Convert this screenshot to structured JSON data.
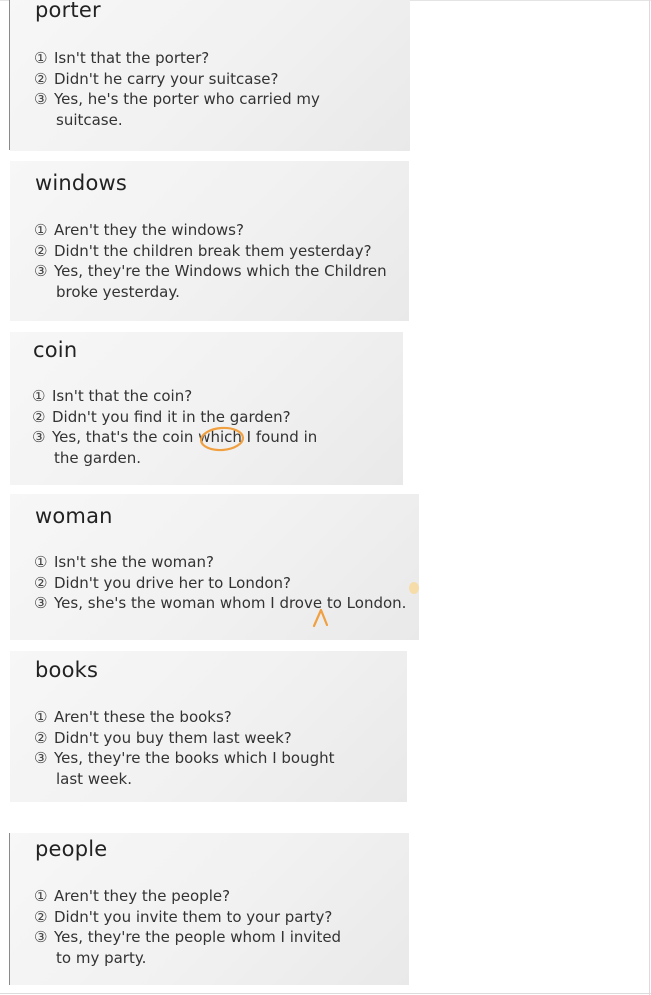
{
  "cards": [
    {
      "word": "porter",
      "lines": [
        {
          "num": "①",
          "text": "Isn't that the porter?"
        },
        {
          "num": "②",
          "text": "Didn't he carry your suitcase?"
        },
        {
          "num": "③",
          "text": "Yes, he's the porter who carried my"
        },
        {
          "num": "",
          "text": "suitcase."
        }
      ]
    },
    {
      "word": "windows",
      "lines": [
        {
          "num": "①",
          "text": "Aren't they the windows?"
        },
        {
          "num": "②",
          "text": "Didn't the children break them yesterday?"
        },
        {
          "num": "③",
          "text": "Yes, they're the Windows which the Children"
        },
        {
          "num": "",
          "text": "broke yesterday."
        }
      ]
    },
    {
      "word": "coin",
      "lines": [
        {
          "num": "①",
          "text": "Isn't that the coin?"
        },
        {
          "num": "②",
          "text": "Didn't you find it in the garden?"
        },
        {
          "num": "③",
          "text": "Yes, that's the coin which I found in"
        },
        {
          "num": "",
          "text": "the garden."
        }
      ]
    },
    {
      "word": "woman",
      "lines": [
        {
          "num": "①",
          "text": "Isn't she the woman?"
        },
        {
          "num": "②",
          "text": "Didn't you drive her to London?"
        },
        {
          "num": "③",
          "text": "Yes, she's the woman whom I drove to London."
        }
      ]
    },
    {
      "word": "books",
      "lines": [
        {
          "num": "①",
          "text": "Aren't these the books?"
        },
        {
          "num": "②",
          "text": "Didn't you buy them last week?"
        },
        {
          "num": "③",
          "text": "Yes, they're the books which I bought"
        },
        {
          "num": "",
          "text": "last week."
        }
      ]
    },
    {
      "word": "people",
      "lines": [
        {
          "num": "①",
          "text": "Aren't they the people?"
        },
        {
          "num": "②",
          "text": "Didn't you invite them to your party?"
        },
        {
          "num": "③",
          "text": "Yes, they're the people whom I invited"
        },
        {
          "num": "",
          "text": "to my party."
        }
      ]
    }
  ],
  "colors": {
    "annotation": "#f0a040",
    "card_bg": "#f3f3f3",
    "text": "#333333"
  }
}
